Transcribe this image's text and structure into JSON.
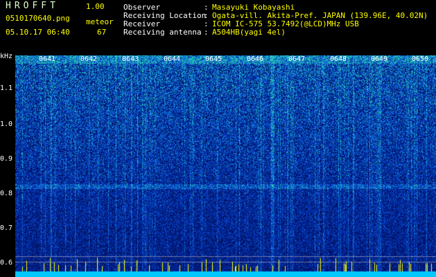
{
  "header": {
    "app_title": "HROFFT",
    "version": "1.00",
    "file_name": "0510170640.png",
    "date_time": "05.10.17 06:40",
    "meteor_label": "meteor",
    "meteor_count": "67",
    "fields": [
      {
        "label": "Observer",
        "value": "Masayuki Kobayashi"
      },
      {
        "label": "Receiving Location",
        "value": "Ogata-vill. Akita-Pref. JAPAN (139.96E, 40.02N)"
      },
      {
        "label": "Receiver",
        "value": "ICOM IC-575 53.7492(@LCD)MHz USB"
      },
      {
        "label": "Receiving antenna",
        "value": "A504HB(yagi 4el)"
      }
    ]
  },
  "spectrogram": {
    "y_unit": "kHz",
    "y_ticks": [
      "1.1",
      "1.0",
      "0.9",
      "0.8",
      "0.7",
      "0.6"
    ],
    "x_ticks": [
      "0641",
      "0642",
      "0643",
      "0644",
      "0645",
      "0646",
      "0647",
      "0648",
      "0649",
      "0650"
    ]
  },
  "colors": {
    "background": "#000000",
    "header_text": "#ffff00",
    "label_text": "#ffffff",
    "spectrum_low": "#00146e",
    "spectrum_high": "#28c8b4",
    "baseline": "#00c8ff",
    "meteor_marks": "#ffff00"
  }
}
